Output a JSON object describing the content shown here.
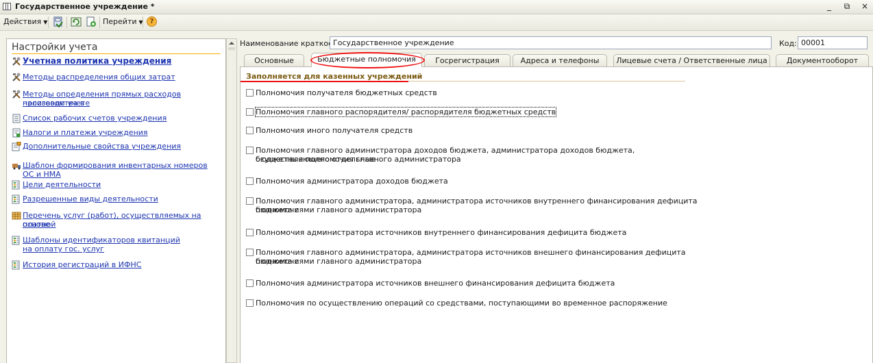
{
  "window": {
    "title": "Государственное учреждение *",
    "controls": [
      "_",
      "⧉",
      "×"
    ]
  },
  "toolbar": {
    "actions_label": "Действия",
    "goto_label": "Перейти",
    "help_symbol": "?"
  },
  "left_panel": {
    "title": "Настройки учета",
    "items": [
      {
        "label": "Учетная политика учреждения",
        "icon": "tools-icon"
      },
      {
        "label": "Методы распределения общих затрат",
        "icon": "tools-icon"
      },
      {
        "label": "Методы определения прямых расходов производства в",
        "label2": "налоговом учете",
        "icon": "tools-icon"
      },
      {
        "label": "Список рабочих счетов учреждения",
        "icon": "list-icon"
      },
      {
        "label": "Налоги и платежи учреждения",
        "icon": "tax-icon"
      },
      {
        "label": "Дополнительные свойства учреждения",
        "icon": "properties-icon"
      },
      {
        "label": "Шаблон формирования инвентарных номеров ОС и НМА",
        "icon": "truck-icon"
      },
      {
        "label": "Цели деятельности",
        "icon": "register-icon"
      },
      {
        "label": "Разрешенные виды деятельности",
        "icon": "register-icon"
      },
      {
        "label": "Перечень услуг (работ), осуществляемых на платной",
        "label2": "основе",
        "icon": "catalog-icon"
      },
      {
        "label": "Шаблоны идентификаторов квитанций",
        "label2": "на оплату гос. услуг",
        "icon": "register-icon"
      },
      {
        "label": "История регистраций в ИФНС",
        "icon": "register-icon"
      }
    ]
  },
  "header": {
    "short_name_label": "Наименование краткое:",
    "short_name_value": "Государственное учреждение",
    "code_label": "Код:",
    "code_value": "00001"
  },
  "tabs": [
    "Основные",
    "Бюджетные полномочия",
    "Госрегистрация",
    "Адреса и телефоны",
    "Лицевые счета / Ответственные лица",
    "Документооборот"
  ],
  "active_tab": "Бюджетные полномочия",
  "group": {
    "title": "Заполняется для казенных учреждений"
  },
  "checkboxes": [
    {
      "label": "Полномочия получателя бюджетных средств",
      "checked": false
    },
    {
      "label": "Полномочия главного распорядителя/ распорядителя бюджетных средств",
      "checked": false
    },
    {
      "label": "Полномочия иного получателя средств",
      "checked": false
    },
    {
      "label": "Полномочия главного администратора доходов бюджета, администратора доходов бюджета, осуществляющего отдельные",
      "label2": "бюджетные полномочия главного администратора",
      "checked": false
    },
    {
      "label": "Полномочия администратора доходов бюджета",
      "checked": false
    },
    {
      "label": "Полномочия главного администратора, администратора источников внутреннего финансирования дефицита бюджета с",
      "label2": "полномочиями главного администратора",
      "checked": false
    },
    {
      "label": "Полномочия администратора источников внутреннего финансирования дефицита бюджета",
      "checked": false
    },
    {
      "label": "Полномочия главного администратора, администратора источников внешнего финансирования дефицита бюджета с",
      "label2": "полномочиями главного администратора",
      "checked": false
    },
    {
      "label": "Полномочия администратора источников внешнего финансирования дефицита бюджета",
      "checked": false
    },
    {
      "label": "Полномочия по осуществлению операций со средствами, поступающими во временное распоряжение",
      "checked": false
    }
  ],
  "colors": {
    "link": "#1c34b0",
    "highlight": "#ee1111",
    "accent": "#ffb000"
  }
}
